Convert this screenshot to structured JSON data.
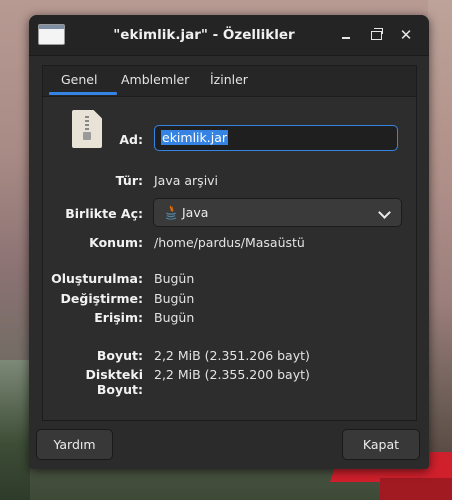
{
  "window": {
    "title": "\"ekimlik.jar\" - Özellikler",
    "icon": "app-window-icon",
    "controls": [
      "minimize-icon",
      "maximize-icon",
      "close-icon"
    ]
  },
  "tabs": [
    {
      "label": "Genel",
      "active": true
    },
    {
      "label": "Amblemler",
      "active": false
    },
    {
      "label": "İzinler",
      "active": false
    }
  ],
  "general": {
    "name_label": "Ad:",
    "name_value": "ekimlik.jar",
    "type_label": "Tür:",
    "type_value": "Java arşivi",
    "open_with_label": "Birlikte Aç:",
    "open_with_value": "Java",
    "location_label": "Konum:",
    "location_value": "/home/pardus/Masaüstü",
    "created_label": "Oluşturulma:",
    "created_value": "Bugün",
    "modified_label": "Değiştirme:",
    "modified_value": "Bugün",
    "accessed_label": "Erişim:",
    "accessed_value": "Bugün",
    "size_label": "Boyut:",
    "size_value": "2,2 MiB (2.351.206 bayt)",
    "disk_size_label": "Diskteki Boyut:",
    "disk_size_value": "2,2 MiB (2.355.200 bayt)"
  },
  "buttons": {
    "help": "Yardım",
    "close": "Kapat"
  },
  "colors": {
    "accent": "#3584e4",
    "window_bg": "#2b2b2b",
    "titlebar_bg": "#242424"
  }
}
